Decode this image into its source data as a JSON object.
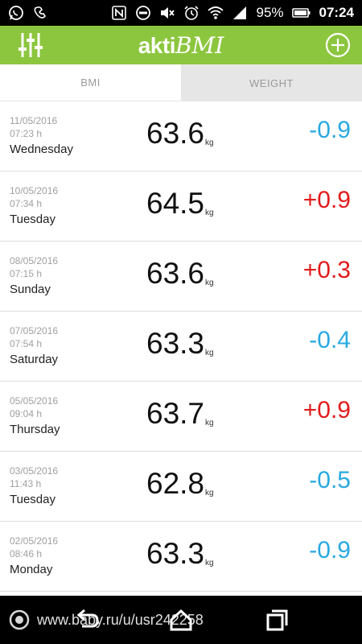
{
  "status_bar": {
    "battery": "95%",
    "time": "07:24",
    "icons_left": [
      "whatsapp-icon",
      "skype-icon"
    ],
    "icons_right": [
      "nfc-icon",
      "dnd-icon",
      "mute-icon",
      "alarm-icon",
      "wifi-icon",
      "signal-icon",
      "battery-icon"
    ]
  },
  "app_bar": {
    "logo_part1": "akti",
    "logo_part2": "BMI",
    "left_icon": "sliders-icon",
    "right_icon": "add-circle-icon",
    "color": "#8cc63f"
  },
  "tabs": [
    {
      "label": "BMI",
      "active": true
    },
    {
      "label": "WEIGHT",
      "active": false
    }
  ],
  "entries": [
    {
      "date": "11/05/2016",
      "time": "07:23 h",
      "day": "Wednesday",
      "weight": "63.6",
      "unit": "kg",
      "delta": "-0.9",
      "trend": "down"
    },
    {
      "date": "10/05/2016",
      "time": "07:34 h",
      "day": "Tuesday",
      "weight": "64.5",
      "unit": "kg",
      "delta": "+0.9",
      "trend": "up"
    },
    {
      "date": "08/05/2016",
      "time": "07:15 h",
      "day": "Sunday",
      "weight": "63.6",
      "unit": "kg",
      "delta": "+0.3",
      "trend": "up"
    },
    {
      "date": "07/05/2016",
      "time": "07:54 h",
      "day": "Saturday",
      "weight": "63.3",
      "unit": "kg",
      "delta": "-0.4",
      "trend": "down"
    },
    {
      "date": "05/05/2016",
      "time": "09:04 h",
      "day": "Thursday",
      "weight": "63.7",
      "unit": "kg",
      "delta": "+0.9",
      "trend": "up"
    },
    {
      "date": "03/05/2016",
      "time": "11:43 h",
      "day": "Tuesday",
      "weight": "62.8",
      "unit": "kg",
      "delta": "-0.5",
      "trend": "down"
    },
    {
      "date": "02/05/2016",
      "time": "08:46 h",
      "day": "Monday",
      "weight": "63.3",
      "unit": "kg",
      "delta": "-0.9",
      "trend": "down"
    }
  ],
  "colors": {
    "negative": "#29a9e1",
    "positive": "#e21b1b"
  },
  "watermark": {
    "text": "www.baby.ru/u/usr242258"
  },
  "nav_bar": {
    "icons": [
      "back-icon",
      "home-icon",
      "recents-icon"
    ]
  }
}
